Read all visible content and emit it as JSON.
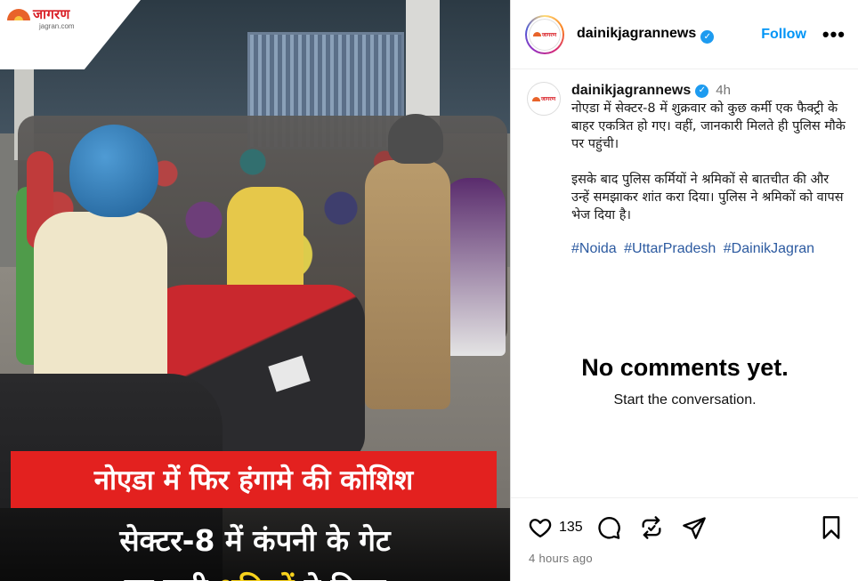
{
  "media": {
    "logo": {
      "name": "जागरण",
      "site": "jagran.com"
    },
    "headline_red": "नोएडा में फिर हंगामे की कोशिश",
    "headline_line2": "सेक्टर-8 में कंपनी के गेट",
    "headline_line3_pre": "पर जुटी ",
    "headline_line3_highlight": "श्रमिकों",
    "headline_line3_post": " ने किया"
  },
  "header": {
    "username": "dainikjagrannews",
    "follow_label": "Follow",
    "more_label": "•••"
  },
  "caption": {
    "username": "dainikjagrannews",
    "time": "4h",
    "para1": "नोएडा में सेक्टर-8 में शुक्रवार को कुछ कर्मी एक फैक्ट्री के बाहर एकत्रित हो गए। वहीं, जानकारी मिलते ही पुलिस मौके पर पहुंची।",
    "para2": "इसके बाद पुलिस कर्मियों ने श्रमिकों से बातचीत की और उन्हें समझाकर शांत करा दिया। पुलिस ने श्रमिकों को वापस भेज दिया है।",
    "hashtags": [
      "#Noida",
      "#UttarPradesh",
      "#DainikJagran"
    ]
  },
  "comments": {
    "empty_title": "No comments yet.",
    "empty_subtitle": "Start the conversation."
  },
  "actions": {
    "like_count": "135",
    "post_age": "4 hours ago",
    "icons": [
      "heart-icon",
      "comment-icon",
      "repost-icon",
      "share-icon",
      "bookmark-icon"
    ]
  },
  "colors": {
    "follow": "#0095f6",
    "verified": "#1d9bf0",
    "headline_red": "#e3211f",
    "highlight_yellow": "#f7d21d"
  }
}
